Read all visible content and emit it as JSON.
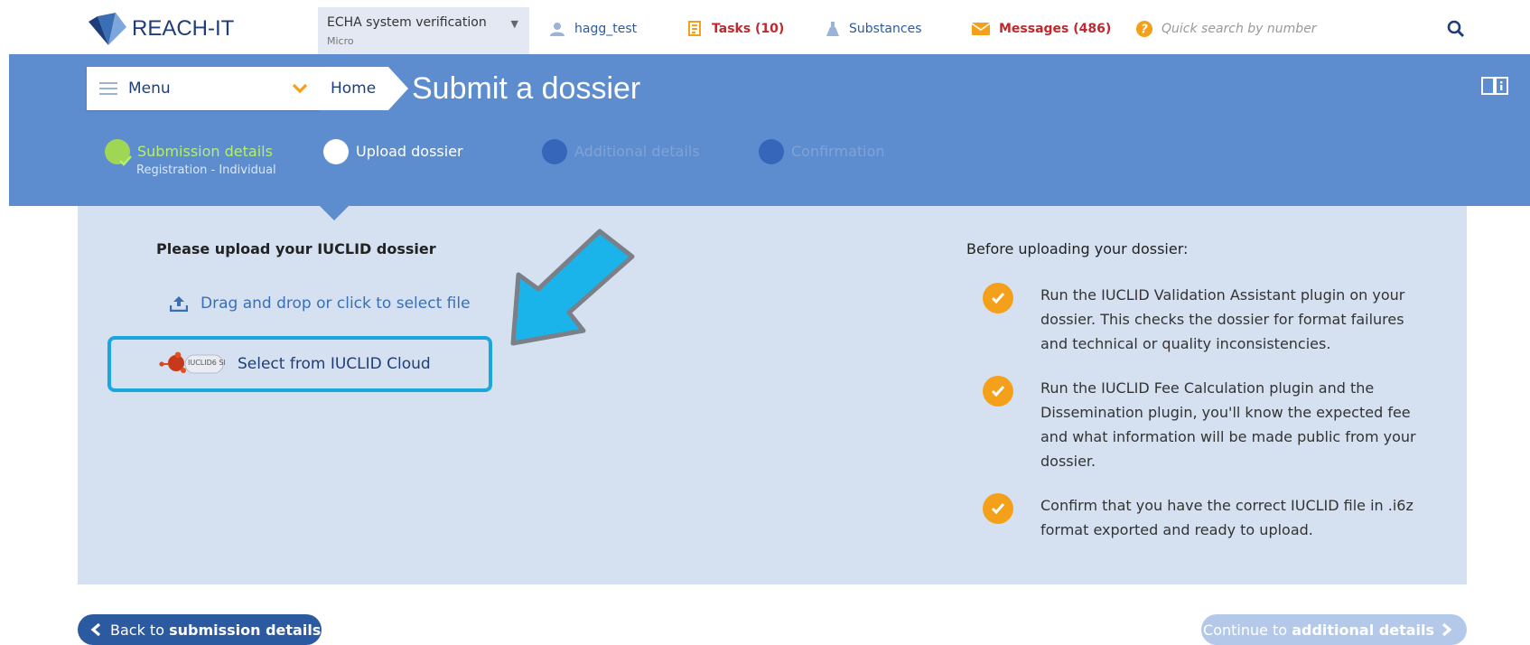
{
  "header": {
    "logo_text": "REACH-IT",
    "org": {
      "name": "ECHA system verification",
      "size": "Micro"
    },
    "user": "hagg_test",
    "tasks": "Tasks (10)",
    "substances": "Substances",
    "messages": "Messages (486)",
    "search_placeholder": "Quick search by number"
  },
  "toolbar": {
    "menu_label": "Menu",
    "breadcrumb_home": "Home",
    "page_title": "Submit a dossier"
  },
  "steps": [
    {
      "label": "Submission details",
      "sub": "Registration - Individual",
      "state": "done"
    },
    {
      "label": "Upload dossier",
      "state": "current"
    },
    {
      "label": "Additional details",
      "state": "pending"
    },
    {
      "label": "Confirmation",
      "state": "pending"
    }
  ],
  "upload": {
    "heading": "Please upload your IUCLID dossier",
    "drop_label": "Drag and drop or click to select file",
    "cloud_label": "Select from IUCLID Cloud",
    "cloud_logo_text": "IUCLID6 SME"
  },
  "before": {
    "heading": "Before uploading your dossier:",
    "items": [
      "Run the IUCLID Validation Assistant plugin on your dossier. This checks the dossier for format failures and technical or quality inconsistencies.",
      "Run the IUCLID Fee Calculation plugin and the Dissemination plugin, you'll know the expected fee and what information will be made public from your dossier.",
      "Confirm that you have the correct IUCLID file in .i6z format exported and ready to upload."
    ]
  },
  "footer": {
    "back_prefix": "Back to ",
    "back_bold": "submission details",
    "continue_prefix": "Continue to ",
    "continue_bold": "additional details"
  },
  "colors": {
    "band": "#5d8ccf",
    "panel": "#d5e1f1",
    "primary": "#2c5aa0",
    "highlight_box": "#1aa7e0",
    "check": "#f5a01a",
    "alert_red": "#c0282d"
  }
}
